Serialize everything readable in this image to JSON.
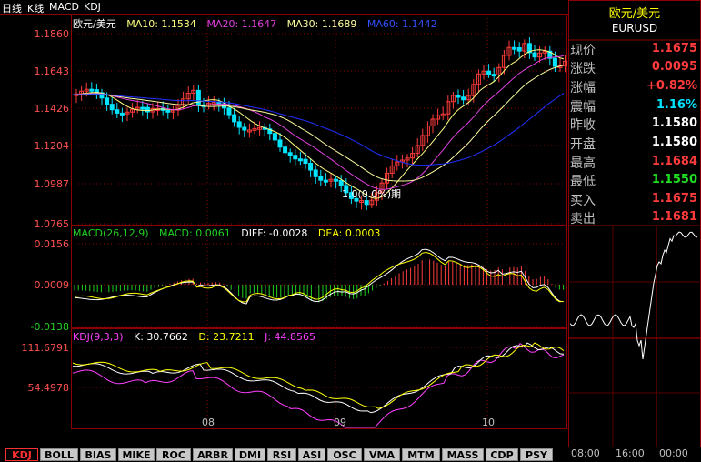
{
  "colors": {
    "bg": "#000000",
    "grid": "#8b0000",
    "up": "#ff3b3b",
    "down": "#00e5ff",
    "ma10": "#ffff80",
    "ma20": "#e040e0",
    "ma30": "#ffffa0",
    "ma60": "#2030ff",
    "macd_pos": "#ff3b3b",
    "macd_neg": "#20d020",
    "diff": "#ffffff",
    "dea": "#ffff00",
    "k": "#ffffff",
    "d": "#ffff00",
    "j": "#ff40ff",
    "intraday": "#ffffff"
  },
  "topbar": {
    "item1": "日线",
    "item2": "K线",
    "item3": "MACD",
    "item4": "KDJ"
  },
  "price_panel": {
    "symbol": "欧元/美元",
    "ma10": "MA10: 1.1534",
    "ma20": "MA20: 1.1647",
    "ma30": "MA30: 1.1689",
    "ma60": "MA60: 1.1442",
    "ticks": [
      "1.1860",
      "1.1643",
      "1.1426",
      "1.1204",
      "1.0987",
      "1.0765"
    ],
    "annotation": "1.0(0.0%)期"
  },
  "macd_panel": {
    "title": "MACD(26,12,9)",
    "macd": "MACD: 0.0061",
    "diff": "DIFF: -0.0028",
    "dea": "DEA: 0.0003",
    "ticks": [
      "0.0156",
      "0.0009",
      "-0.0138"
    ]
  },
  "kdj_panel": {
    "title": "KDJ(9,3,3)",
    "k": "K: 30.7662",
    "d": "D: 23.7211",
    "j": "J: 44.8565",
    "ticks": [
      "111.6791",
      "54.4978"
    ]
  },
  "x_axis": [
    "08",
    "09",
    "10"
  ],
  "quote": {
    "title": "欧元/美元",
    "symbol": "EURUSD",
    "rows": [
      {
        "label": "现价",
        "value": "1.1675",
        "color": "#ff3b3b"
      },
      {
        "label": "涨跌",
        "value": "0.0095",
        "color": "#ff3b3b"
      },
      {
        "label": "涨幅",
        "value": "+0.82%",
        "color": "#ff3b3b"
      },
      {
        "label": "震幅",
        "value": "1.16%",
        "color": "#00e5ff"
      },
      {
        "label": "昨收",
        "value": "1.1580",
        "color": "#ffffff"
      },
      {
        "label": "开盘",
        "value": "1.1580",
        "color": "#ffffff"
      },
      {
        "label": "最高",
        "value": "1.1684",
        "color": "#ff3b3b"
      },
      {
        "label": "最低",
        "value": "1.1550",
        "color": "#20e020"
      },
      {
        "label": "买入",
        "value": "1.1675",
        "color": "#ff3b3b"
      },
      {
        "label": "卖出",
        "value": "1.1681",
        "color": "#ff3b3b"
      }
    ]
  },
  "intraday": {
    "times": [
      "08:00",
      "16:00",
      "00:00"
    ]
  },
  "tabs": [
    "KDJ",
    "BOLL",
    "BIAS",
    "MIKE",
    "ROC",
    "ARBR",
    "DMI",
    "RSI",
    "ASI",
    "OSC",
    "VMA",
    "MTM",
    "MASS",
    "CDP",
    "PSY"
  ],
  "active_tab": "KDJ"
}
